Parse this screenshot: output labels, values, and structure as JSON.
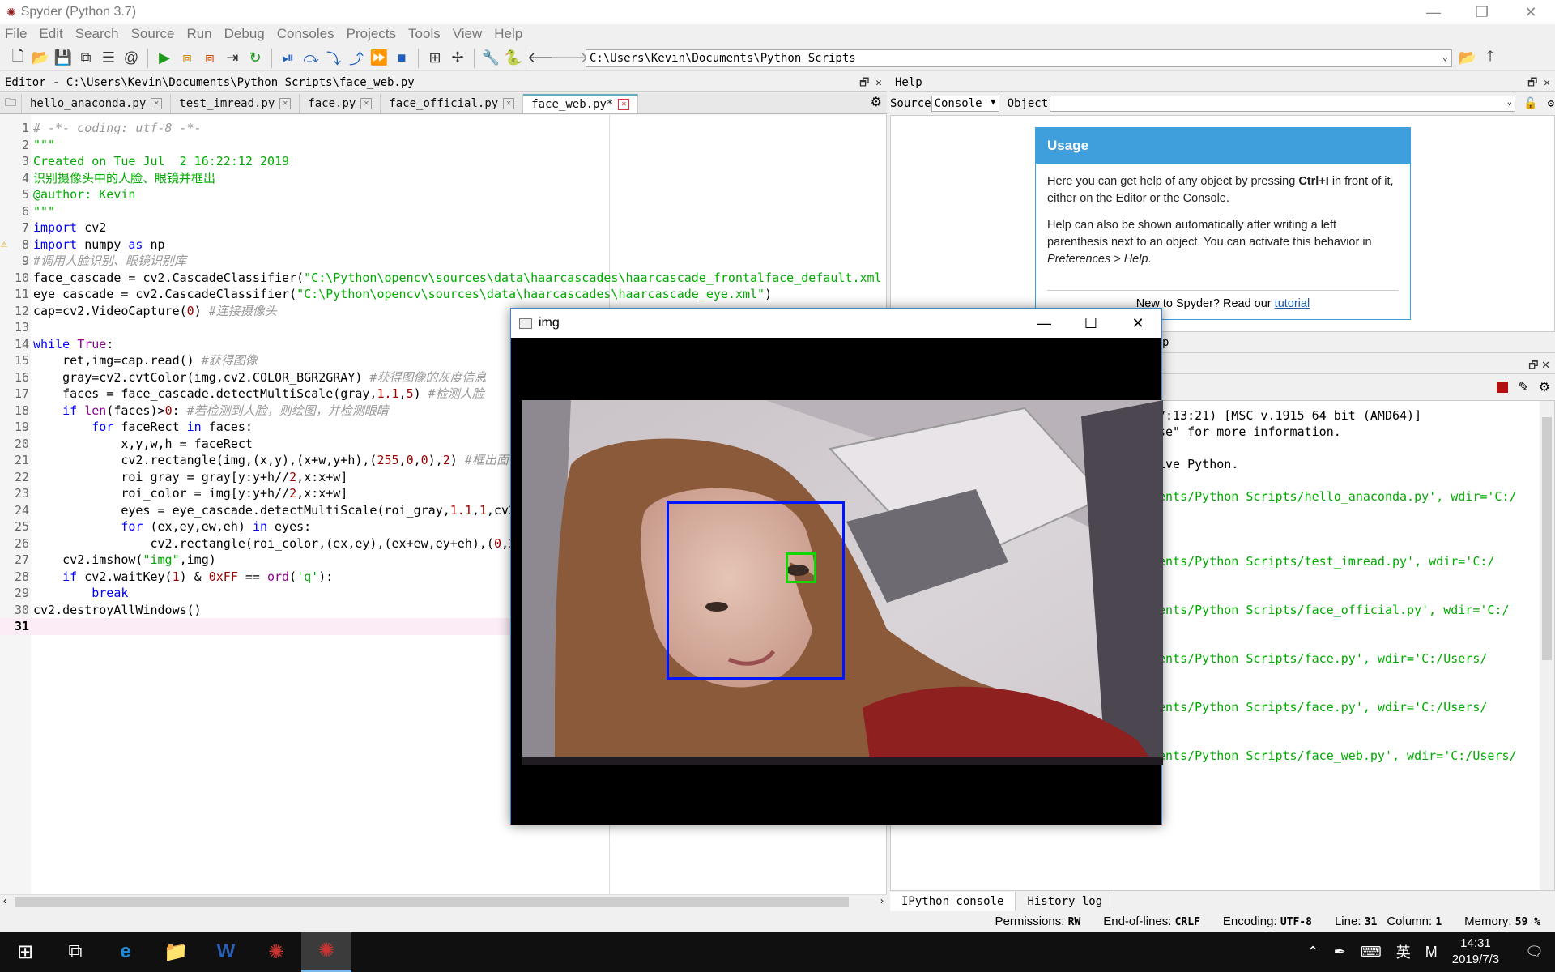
{
  "window": {
    "title": "Spyder (Python 3.7)",
    "min": "—",
    "restore": "❐",
    "close": "✕"
  },
  "menu": [
    "File",
    "Edit",
    "Search",
    "Source",
    "Run",
    "Debug",
    "Consoles",
    "Projects",
    "Tools",
    "View",
    "Help"
  ],
  "toolbar": {
    "path": "C:\\Users\\Kevin\\Documents\\Python Scripts"
  },
  "editor": {
    "header": "Editor - C:\\Users\\Kevin\\Documents\\Python Scripts\\face_web.py",
    "tabs": [
      "hello_anaconda.py",
      "test_imread.py",
      "face.py",
      "face_official.py",
      "face_web.py*"
    ],
    "active_tab": 4,
    "current_line": 31,
    "warning_line": 8
  },
  "help": {
    "header": "Help",
    "source_label": "Source",
    "source_value": "Console",
    "object_label": "Object",
    "usage_title": "Usage",
    "usage_p1_a": "Here you can get help of any object by pressing ",
    "usage_p1_b": "Ctrl+I",
    "usage_p1_c": " in front of it, either on the Editor or the Console.",
    "usage_p2_a": "Help can also be shown automatically after writing a left parenthesis next to an object. You can activate this behavior in ",
    "usage_p2_b": "Preferences > Help",
    "usage_p2_c": ".",
    "new_text": "New to Spyder? Read our ",
    "tutorial": "tutorial",
    "partial_tab": "p"
  },
  "console": {
    "lines": [
      {
        "t": "7:13:21) [MSC v.1915 64 bit (AMD64)]",
        "g": false
      },
      {
        "t": "se\" for more information.",
        "g": false
      },
      {
        "t": "",
        "g": false
      },
      {
        "t": "ive Python.",
        "g": false
      },
      {
        "t": "",
        "g": false
      },
      {
        "t": "ents/Python Scripts/hello_anaconda.py', wdir='C:/",
        "g": true
      },
      {
        "t": ")",
        "g": true
      },
      {
        "t": "",
        "g": false
      },
      {
        "t": "",
        "g": false
      },
      {
        "t": "ents/Python Scripts/test_imread.py', wdir='C:/",
        "g": true
      },
      {
        "t": ")",
        "g": true
      },
      {
        "t": "",
        "g": false
      },
      {
        "t": "ents/Python Scripts/face_official.py', wdir='C:/",
        "g": true
      },
      {
        "t": ")",
        "g": true
      },
      {
        "t": "",
        "g": false
      },
      {
        "t": "ents/Python Scripts/face.py', wdir='C:/Users/",
        "g": true
      },
      {
        "t": "",
        "g": false
      },
      {
        "t": "",
        "g": false
      },
      {
        "t": "ents/Python Scripts/face.py', wdir='C:/Users/",
        "g": true
      },
      {
        "t": "",
        "g": false
      },
      {
        "t": "",
        "g": false
      },
      {
        "t": "ents/Python Scripts/face_web.py', wdir='C:/Users/",
        "g": true
      }
    ],
    "tabs": [
      "IPython console",
      "History log"
    ]
  },
  "status": {
    "permissions_label": "Permissions:",
    "permissions": "RW",
    "eol_label": "End-of-lines:",
    "eol": "CRLF",
    "encoding_label": "Encoding:",
    "encoding": "UTF-8",
    "line_label": "Line:",
    "line": "31",
    "column_label": "Column:",
    "column": "1",
    "memory_label": "Memory:",
    "memory": "59 %"
  },
  "imgwin": {
    "title": "img",
    "min": "—",
    "max": "☐",
    "close": "✕"
  },
  "taskbar": {
    "time": "14:31",
    "date": "2019/7/3",
    "ime": "英",
    "ime2": "M"
  }
}
